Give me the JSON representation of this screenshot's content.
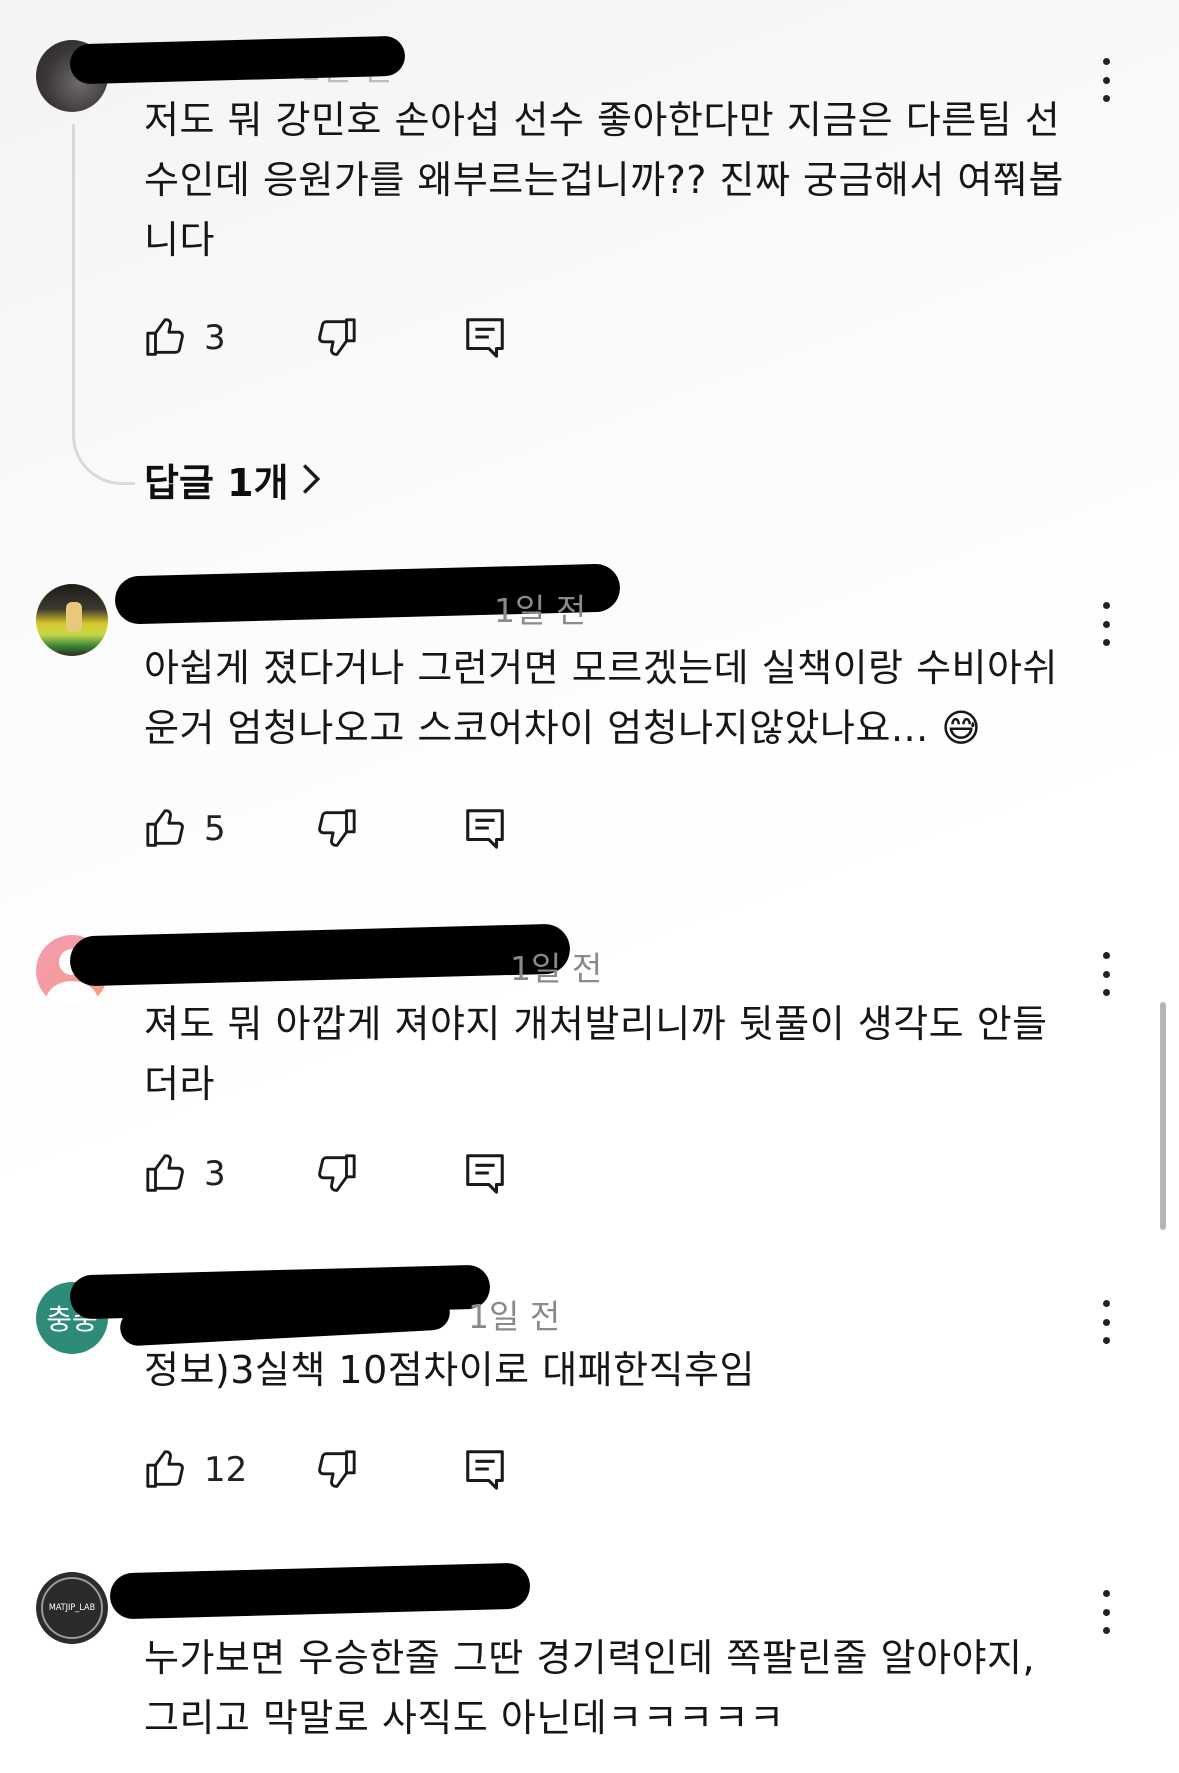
{
  "comments": [
    {
      "time": "1년 전",
      "text": "저도 뭐 강민호 손아섭 선수 좋아한다만 지금은 다른팀 선\n수인데 응원가를 왜부르는겁니까?? 진짜 궁금해서 여쭤봅\n니다",
      "likes": "3",
      "avatar_icon": "avatar-dark-icon"
    },
    {
      "time": "1일 전",
      "text": "아쉽게 졌다거나 그런거면 모르겠는데 실책이랑 수비아쉬\n운거 엄청나오고 스코어차이 엄청나지않았나요... 😅",
      "likes": "5",
      "avatar_icon": "avatar-photo-icon"
    },
    {
      "time": "1일 전",
      "text": "져도 뭐 아깝게 져야지 개처발리니까 뒷풀이 생각도 안들\n더라",
      "likes": "3",
      "avatar_icon": "avatar-default-person-icon"
    },
    {
      "time": "1일 전",
      "text": "정보)3실책 10점차이로 대패한직후임",
      "likes": "12",
      "avatar_text": "충충",
      "avatar_icon": "avatar-text-icon"
    },
    {
      "time": "",
      "text": "누가보면 우승한줄 그딴 경기력인데 쪽팔린줄 알아야지,\n그리고 막말로 사직도 아닌데ㅋㅋㅋㅋㅋ",
      "likes": "",
      "avatar_text": "MATJIP_LAB",
      "avatar_icon": "avatar-logo-icon"
    }
  ],
  "replies_label": "답글 1개",
  "colors": {
    "text": "#161616",
    "muted": "#8a8a8a",
    "avatar_green": "#2e8b7a"
  }
}
